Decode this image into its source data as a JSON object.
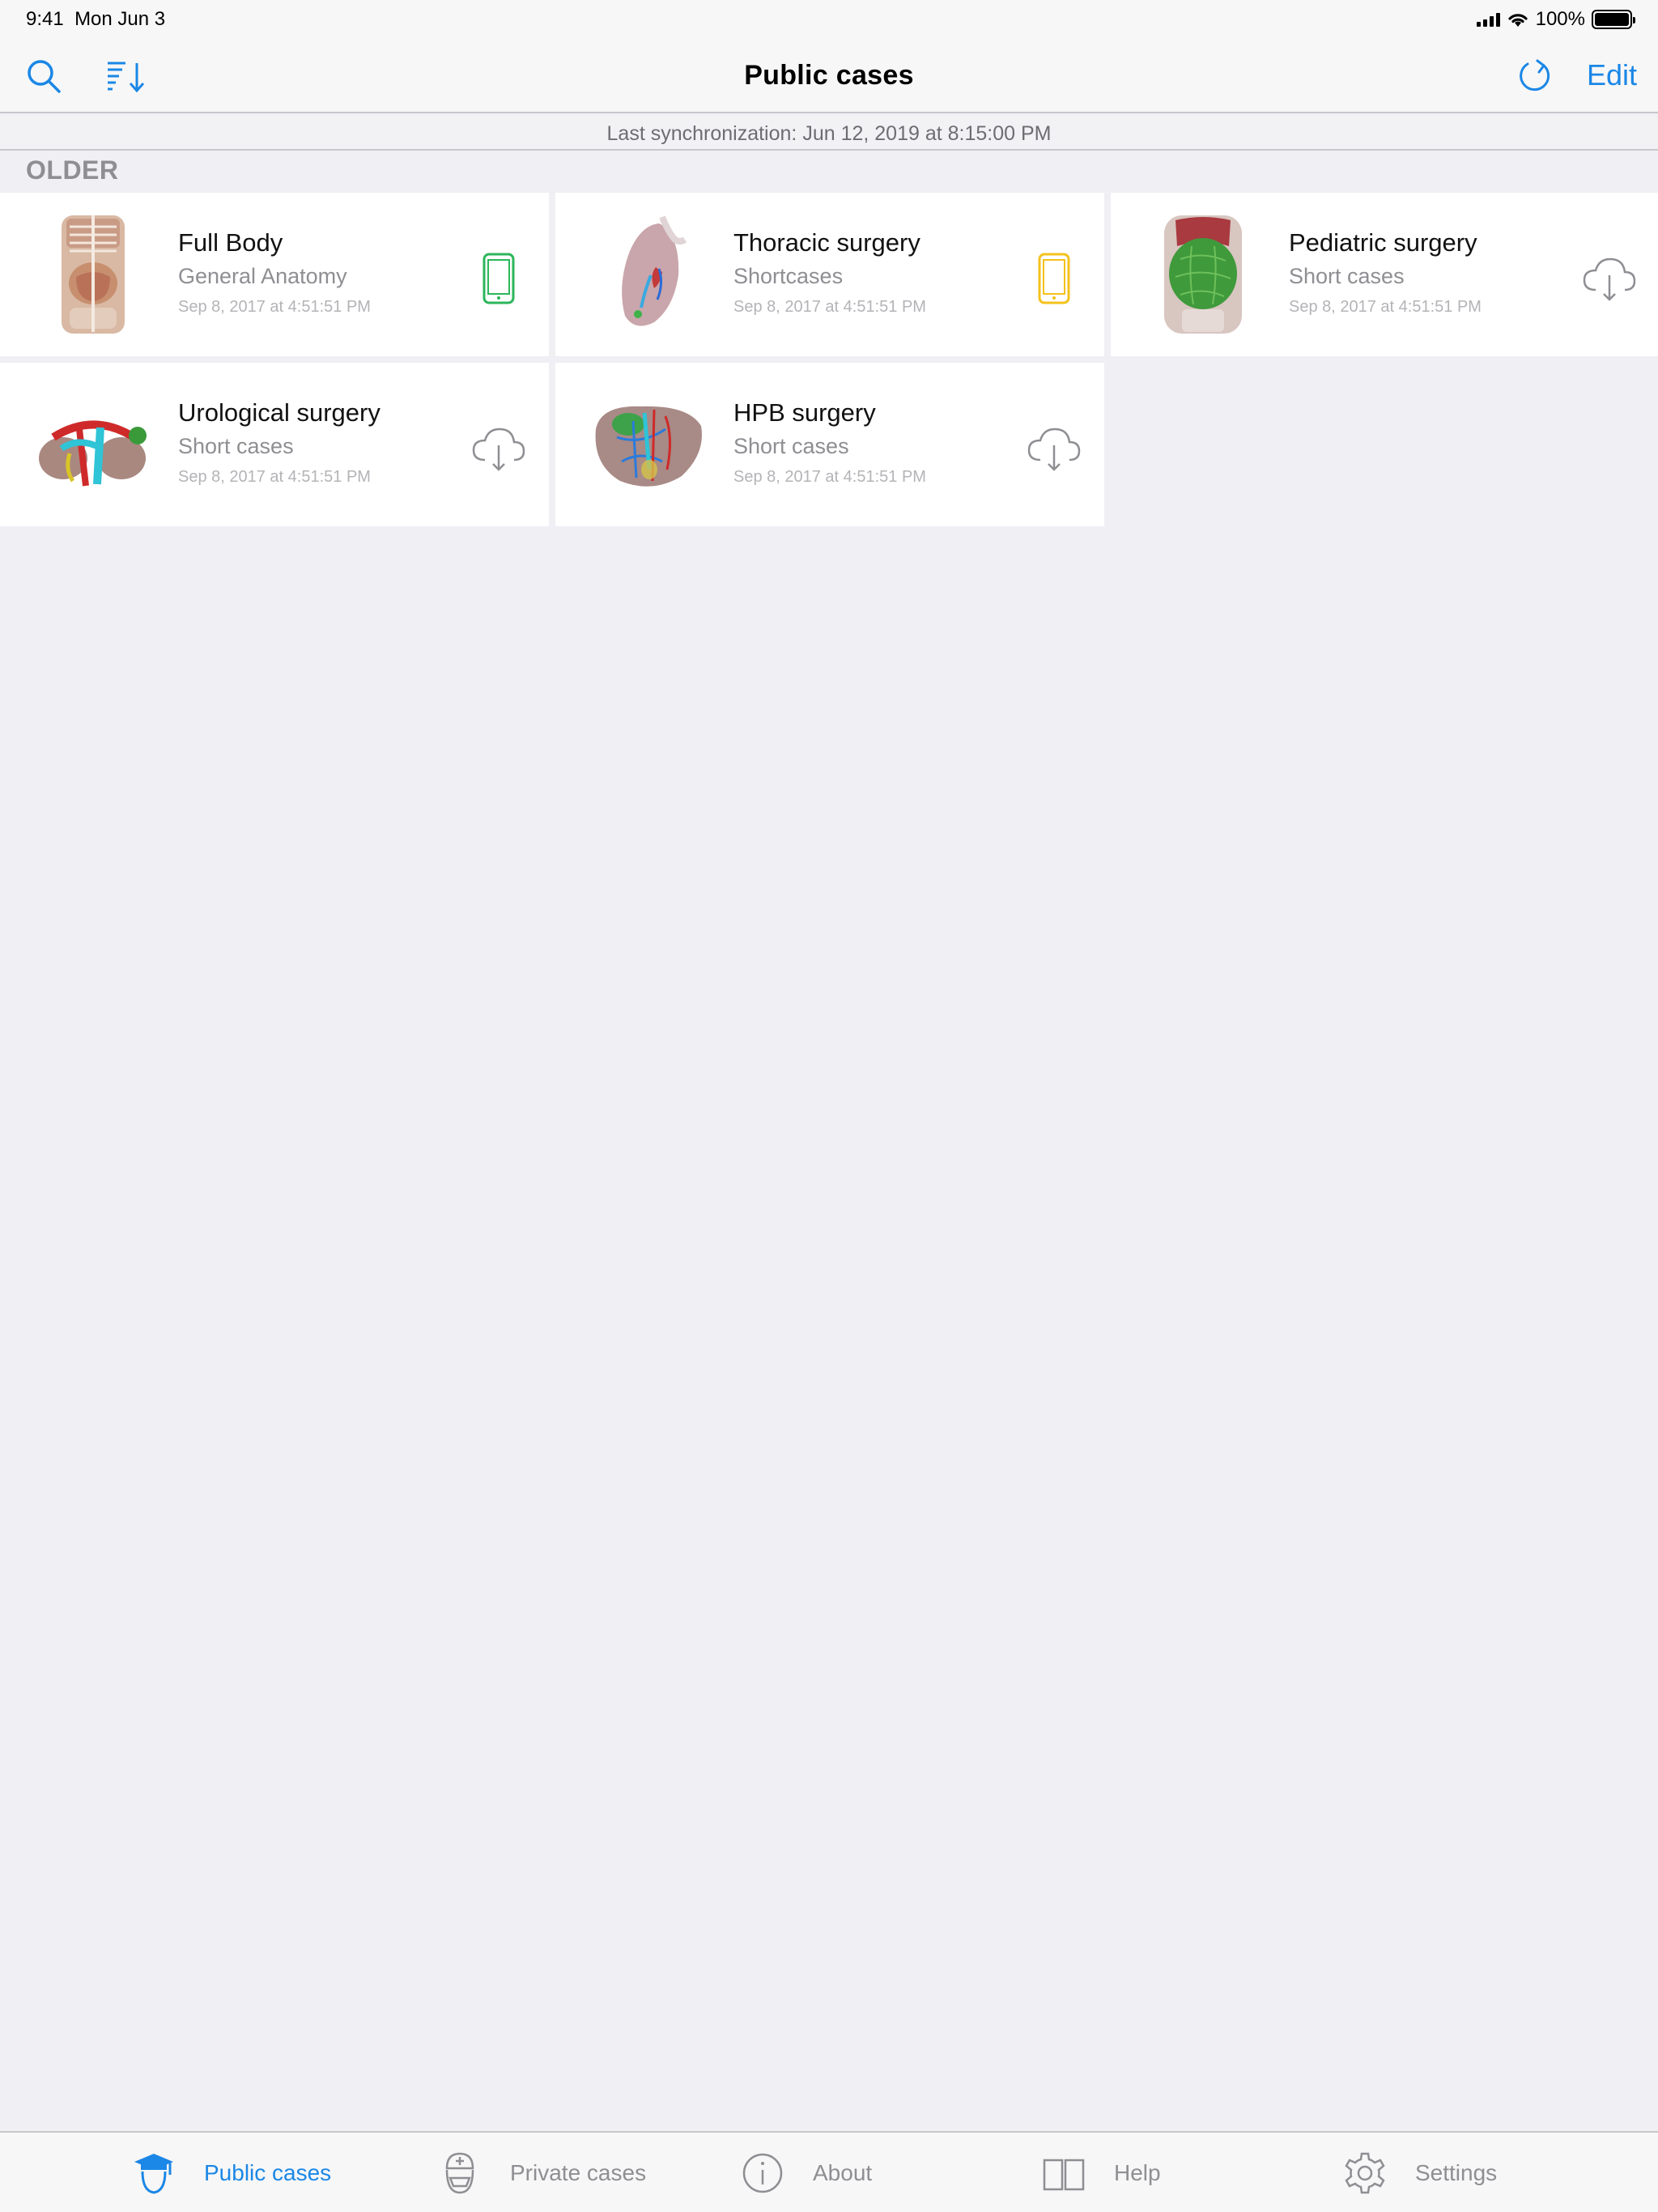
{
  "status_bar": {
    "time": "9:41",
    "date": "Mon Jun 3",
    "battery": "100%"
  },
  "nav": {
    "title": "Public cases",
    "edit_label": "Edit"
  },
  "sync_text": "Last synchronization: Jun 12, 2019 at 8:15:00 PM",
  "section_header": "OLDER",
  "cases": [
    {
      "title": "Full Body",
      "subtitle": "General Anatomy",
      "date": "Sep 8, 2017 at 4:51:51 PM",
      "status": "on-device-green",
      "thumb": "full-body"
    },
    {
      "title": "Thoracic surgery",
      "subtitle": "Shortcases",
      "date": "Sep 8, 2017 at 4:51:51 PM",
      "status": "on-device-yellow",
      "thumb": "thoracic"
    },
    {
      "title": "Pediatric surgery",
      "subtitle": "Short cases",
      "date": "Sep 8, 2017 at 4:51:51 PM",
      "status": "cloud-download",
      "thumb": "pediatric"
    },
    {
      "title": "Urological surgery",
      "subtitle": "Short cases",
      "date": "Sep 8, 2017 at 4:51:51 PM",
      "status": "cloud-download",
      "thumb": "urological"
    },
    {
      "title": "HPB surgery",
      "subtitle": "Short cases",
      "date": "Sep 8, 2017 at 4:51:51 PM",
      "status": "cloud-download",
      "thumb": "hpb"
    }
  ],
  "tabs": [
    {
      "label": "Public cases",
      "icon": "graduation-cap-icon",
      "active": true
    },
    {
      "label": "Private cases",
      "icon": "surgeon-icon",
      "active": false
    },
    {
      "label": "About",
      "icon": "info-icon",
      "active": false
    },
    {
      "label": "Help",
      "icon": "book-icon",
      "active": false
    },
    {
      "label": "Settings",
      "icon": "gear-icon",
      "active": false
    }
  ],
  "colors": {
    "accent": "#1b87e6",
    "on_device_green": "#2cb65b",
    "on_device_yellow": "#f4c21b",
    "cloud_gray": "#8e8e93"
  }
}
